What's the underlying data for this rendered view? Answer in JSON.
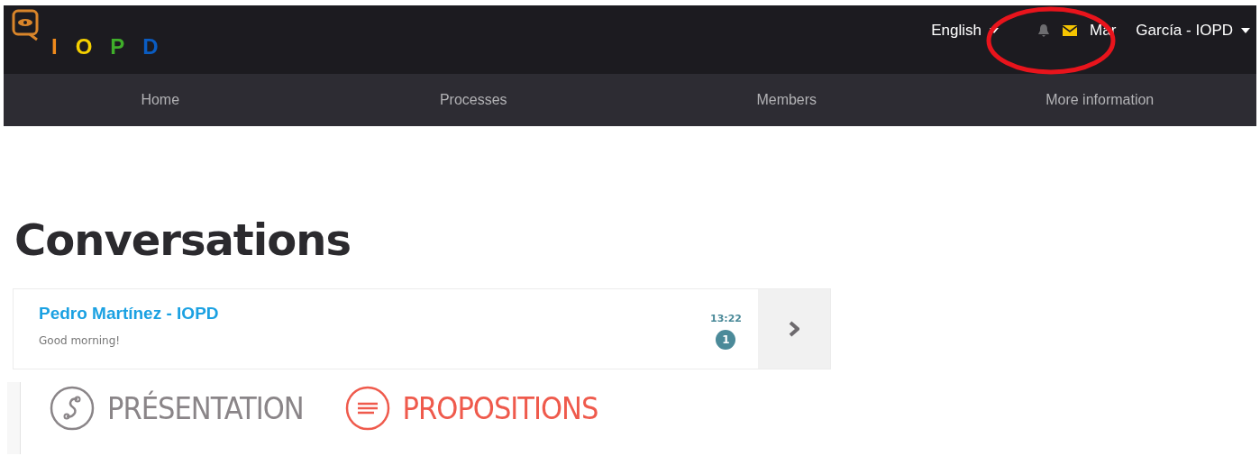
{
  "header": {
    "logo_letters": [
      {
        "text": "I",
        "color": "#f08a1c"
      },
      {
        "text": "O",
        "color": "#f5d000"
      },
      {
        "text": "P",
        "color": "#3fae2a"
      },
      {
        "text": "D",
        "color": "#0a5cc2"
      }
    ],
    "language": "English",
    "notifications": {
      "unread": false
    },
    "messages": {
      "unread": true
    },
    "user_name_parts": [
      "Mar",
      "García - IOPD"
    ]
  },
  "nav": [
    {
      "label": "Home"
    },
    {
      "label": "Processes"
    },
    {
      "label": "Members"
    },
    {
      "label": "More information"
    }
  ],
  "page_title": "Conversations",
  "conversations": [
    {
      "name": "Pedro Martínez - IOPD",
      "preview": "Good morning!",
      "time": "13:22",
      "unread_count": "1"
    }
  ],
  "tabs": [
    {
      "label": "PRÉSENTATION",
      "selected": false,
      "kind": "presentation"
    },
    {
      "label": "PROPOSITIONS",
      "selected": true,
      "kind": "propositions"
    }
  ],
  "annotation": {
    "kind": "ellipse",
    "color": "#e8141c"
  }
}
